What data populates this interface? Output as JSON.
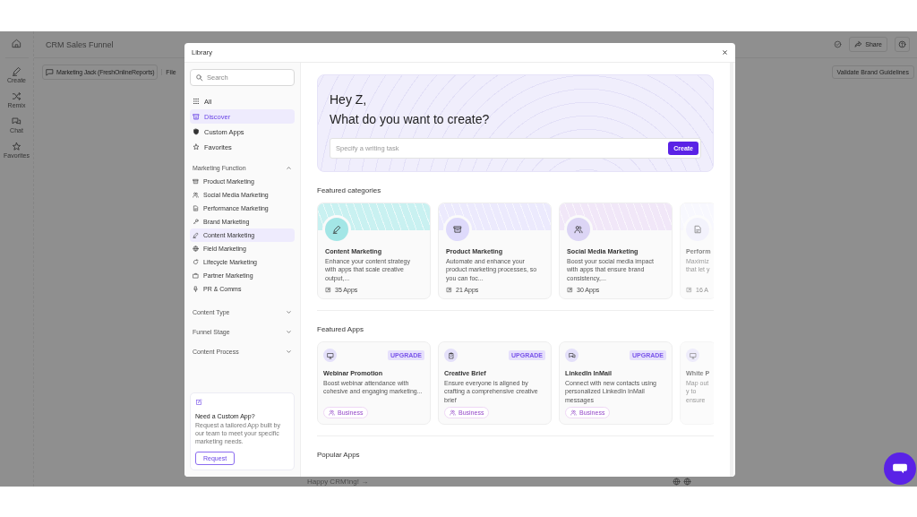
{
  "app": {
    "title": "CRM Sales Funnel",
    "rail": [
      {
        "label": "Create"
      },
      {
        "label": "Remix"
      },
      {
        "label": "Chat"
      },
      {
        "label": "Favorites"
      }
    ],
    "share": "Share",
    "toolbar": {
      "account": "Marketing Jack (FreshOnlineReports)",
      "menu": "File",
      "action": "Validate Brand Guidelines"
    },
    "footer": "Happy CRM'ing! →"
  },
  "library": {
    "title": "Library",
    "search": {
      "placeholder": "Search"
    },
    "nav": [
      {
        "label": "All",
        "selected": false
      },
      {
        "label": "Discover",
        "selected": true
      },
      {
        "label": "Custom Apps",
        "selected": false
      },
      {
        "label": "Favorites",
        "selected": false
      }
    ],
    "sections": [
      {
        "title": "Marketing Function",
        "expanded": true,
        "items": [
          {
            "label": "Product Marketing",
            "selected": false
          },
          {
            "label": "Social Media Marketing",
            "selected": false
          },
          {
            "label": "Performance Marketing",
            "selected": false
          },
          {
            "label": "Brand Marketing",
            "selected": false
          },
          {
            "label": "Content Marketing",
            "selected": true
          },
          {
            "label": "Field Marketing",
            "selected": false
          },
          {
            "label": "Lifecycle Marketing",
            "selected": false
          },
          {
            "label": "Partner Marketing",
            "selected": false
          },
          {
            "label": "PR & Comms",
            "selected": false
          }
        ]
      },
      {
        "title": "Content Type",
        "expanded": false
      },
      {
        "title": "Funnel Stage",
        "expanded": false
      },
      {
        "title": "Content Process",
        "expanded": false
      }
    ],
    "custom_app": {
      "title": "Need a Custom App?",
      "text": "Request a tailored App built by our team to meet your specific marketing needs.",
      "button": "Request"
    },
    "hero": {
      "greeting": "Hey Z,",
      "question": "What do you want to create?",
      "placeholder": "Specify a writing task",
      "button": "Create"
    },
    "featured_categories": {
      "title": "Featured categories",
      "items": [
        {
          "name": "Content Marketing",
          "description": "Enhance your content strategy with apps that scale creative output,...",
          "count": "35 Apps",
          "color": "#c9f1f1"
        },
        {
          "name": "Product Marketing",
          "description": "Automate and enhance your product marketing processes, so you can foc...",
          "count": "21 Apps",
          "color": "#eceafd"
        },
        {
          "name": "Social Media Marketing",
          "description": "Boost your social media impact with apps that ensure brand consistency,...",
          "count": "30 Apps",
          "color": "#f1e7f8"
        },
        {
          "name": "Perform",
          "description": "Maximiz that let y",
          "count": "16 A",
          "color": "#f4f3fd"
        }
      ]
    },
    "featured_apps": {
      "title": "Featured Apps",
      "items": [
        {
          "name": "Webinar Promotion",
          "description": "Boost webinar attendance with cohesive and engaging marketing...",
          "badge": "UPGRADE",
          "tag": "Business"
        },
        {
          "name": "Creative Brief",
          "description": "Ensure everyone is aligned by crafting a comprehensive creative brief",
          "badge": "UPGRADE",
          "tag": "Business"
        },
        {
          "name": "LinkedIn InMail",
          "description": "Connect with new contacts using personalized LinkedIn InMail messages",
          "badge": "UPGRADE",
          "tag": "Business"
        },
        {
          "name": "White P",
          "description": "Map out y to ensure"
        }
      ]
    },
    "popular_apps": {
      "title": "Popular Apps"
    }
  }
}
